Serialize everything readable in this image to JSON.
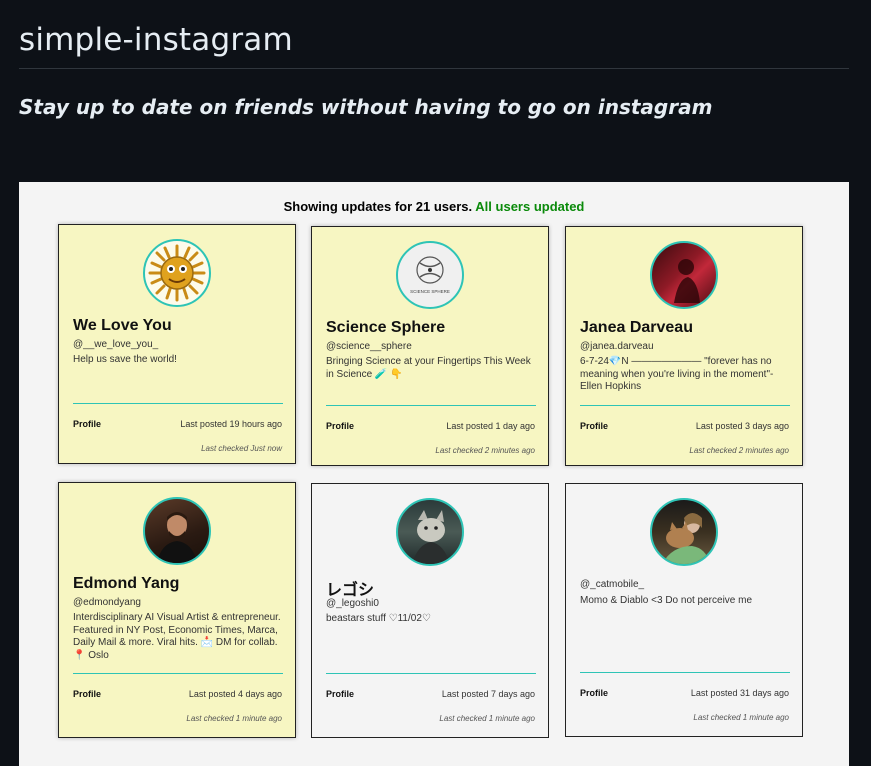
{
  "page": {
    "title": "simple-instagram",
    "subtitle": "Stay up to date on friends without having to go on instagram"
  },
  "status": {
    "prefix": "Showing updates for 21 users.",
    "updated": "All users updated"
  },
  "cards": [
    {
      "name": "We Love You",
      "handle": "@__we_love_you_",
      "bio": "Help us save the world!",
      "profile": "Profile",
      "posted": "Last posted 19 hours ago",
      "checked": "Last checked Just now"
    },
    {
      "name": "Science Sphere",
      "handle": "@science__sphere",
      "bio": "Bringing Science at your Fingertips This Week in Science 🧪 👇",
      "profile": "Profile",
      "posted": "Last posted 1 day ago",
      "checked": "Last checked 2 minutes ago",
      "avatar_text": "SCIENCE SPHERE"
    },
    {
      "name": "Janea Darveau",
      "handle": "@janea.darveau",
      "bio": "6-7-24💎N ——————— \"forever has no meaning when you're living in the moment\"- Ellen Hopkins",
      "profile": "Profile",
      "posted": "Last posted 3 days ago",
      "checked": "Last checked 2 minutes ago"
    },
    {
      "name": "Edmond Yang",
      "handle": "@edmondyang",
      "bio": "Interdisciplinary AI Visual Artist & entrepreneur. Featured in NY Post, Economic Times, Marca, Daily Mail & more. Viral hits. 📩 DM for collab. 📍 Oslo",
      "profile": "Profile",
      "posted": "Last posted 4 days ago",
      "checked": "Last checked 1 minute ago"
    },
    {
      "name": "レゴシ",
      "handle": "@_legoshi0",
      "bio": "beastars stuff ♡11/02♡",
      "profile": "Profile",
      "posted": "Last posted 7 days ago",
      "checked": "Last checked 1 minute ago"
    },
    {
      "name": "",
      "handle": "@_catmobile_",
      "bio": "Momo & Diablo <3 Do not perceive me",
      "profile": "Profile",
      "posted": "Last posted 31 days ago",
      "checked": "Last checked 1 minute ago"
    }
  ],
  "colors": {
    "page_bg": "#0d1117",
    "panel_bg": "#f4f4f4",
    "card_yellow": "#f7f6c2",
    "accent_teal": "#2ec4b6",
    "status_green": "#0a8a0a"
  }
}
